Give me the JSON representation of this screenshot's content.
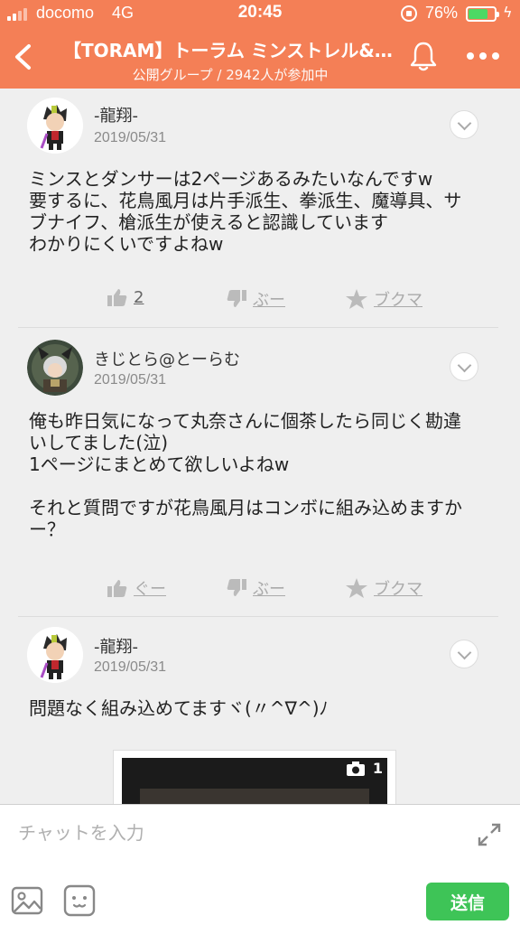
{
  "status_bar": {
    "carrier": "docomo",
    "network": "4G",
    "time": "20:45",
    "battery_percent": "76%",
    "battery_level": 0.76,
    "battery_color": "#4cd964"
  },
  "header": {
    "background": "#f47f56",
    "title": "【TORAM】トーラム ミンストレル&…",
    "subtitle": "公開グループ / 2942人が参加中",
    "icons": [
      "back-icon",
      "bell-icon",
      "more-icon"
    ]
  },
  "posts": [
    {
      "author": "-龍翔-",
      "date": "2019/05/31",
      "lines": [
        "ミンスとダンサーは2ページあるみたいなんですw",
        "要するに、花鳥風月は片手派生、拳派生、魔導具、サ",
        "ブナイフ、槍派生が使えると認識しています",
        "わかりにくいですよねw"
      ],
      "good_label": "2",
      "bad_label": "ぶー",
      "fav_label": "ブクマ"
    },
    {
      "author": "きじとら@とーらむ",
      "date": "2019/05/31",
      "lines": [
        "俺も昨日気になって丸奈さんに個茶したら同じく勘違",
        "いしてました(泣)",
        "1ページにまとめて欲しいよねw",
        "",
        "それと質問ですが花鳥風月はコンボに組み込めますか",
        "ー？"
      ],
      "good_label": "ぐー",
      "bad_label": "ぶー",
      "fav_label": "ブクマ"
    },
    {
      "author": "-龍翔-",
      "date": "2019/05/31",
      "lines": [
        "問題なく組み込めてますヾ(〃^∇^)ﾉ"
      ],
      "image_count": "1"
    }
  ],
  "input_bar": {
    "placeholder": "チャットを入力",
    "send_label": "送信",
    "send_color": "#3ec457",
    "icons": [
      "expand-icon",
      "image-icon",
      "sticker-icon"
    ]
  }
}
